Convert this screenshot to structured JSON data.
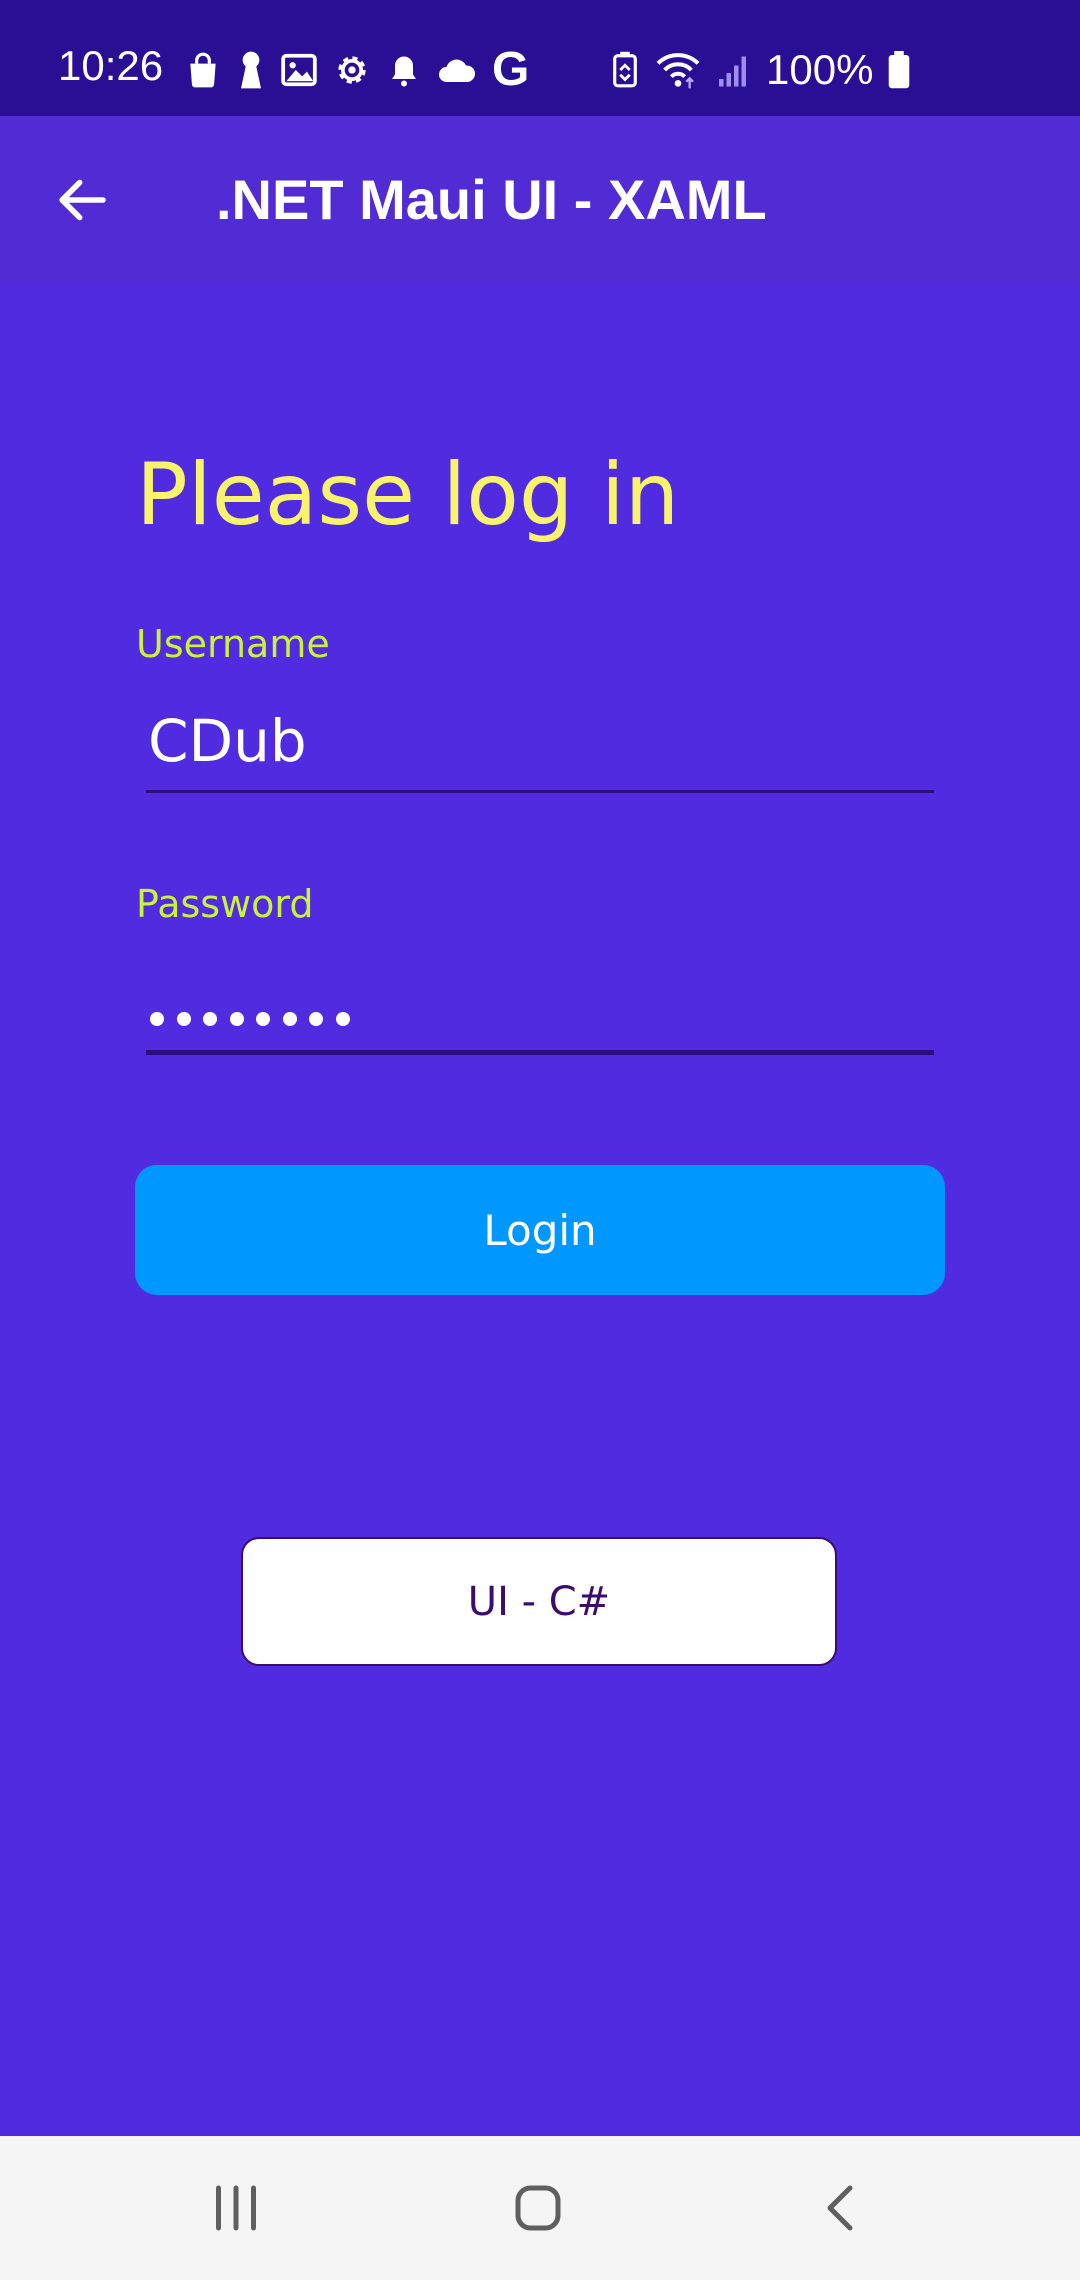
{
  "status_bar": {
    "time": "10:26",
    "battery": "100%",
    "icons_left": [
      "shopping-bag-icon",
      "keyhole-icon",
      "image-icon",
      "settings-icon",
      "bell-icon",
      "cloud-icon",
      "google-icon"
    ],
    "google_letter": "G",
    "icons_right": [
      "battery-saver-icon",
      "wifi-icon",
      "signal-icon",
      "battery-icon"
    ]
  },
  "app_bar": {
    "title": ".NET Maui UI - XAML",
    "back_icon": "arrow-left-icon"
  },
  "login_form": {
    "heading": "Please log in",
    "username_label": "Username",
    "username_value": "CDub",
    "password_label": "Password",
    "password_length": 8,
    "login_button": "Login"
  },
  "secondary_button": "UI - C#",
  "nav_bar": {
    "icons": [
      "recent-apps-icon",
      "home-icon",
      "back-icon"
    ]
  },
  "colors": {
    "status_bar": "#2A0E94",
    "app_bar": "#512BD4",
    "background": "#512BDF",
    "heading": "#F8F36C",
    "field_label": "#C9F23A",
    "login_button": "#0097FF",
    "secondary_button_text": "#3B0B6E",
    "nav_bar": "#F5F5F5"
  }
}
